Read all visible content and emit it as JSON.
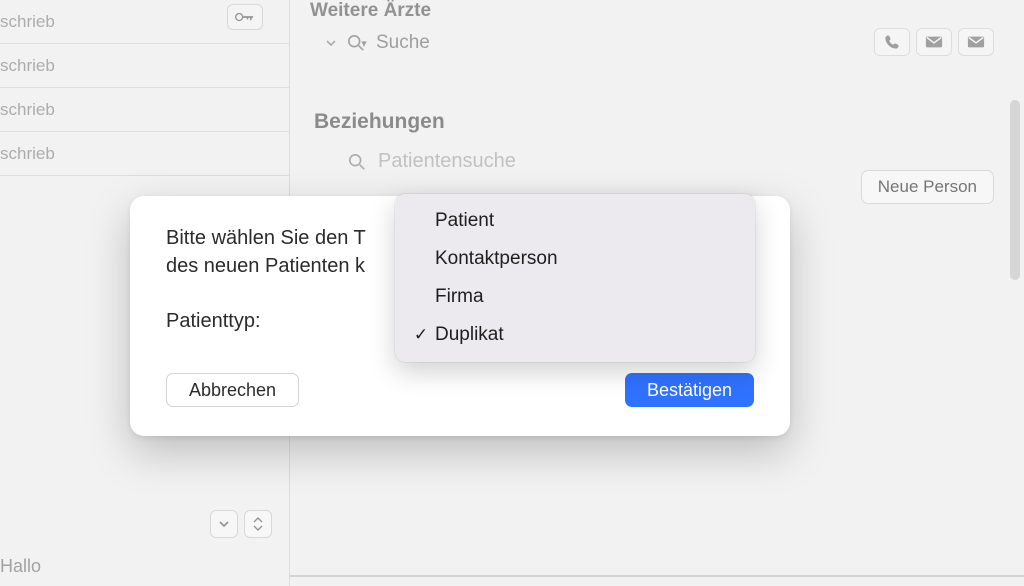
{
  "sidebar": {
    "items": [
      "schrieb",
      "schrieb",
      "schrieb",
      "schrieb"
    ],
    "note": "Hallo"
  },
  "content": {
    "section1_title": "Weitere Ärzte",
    "search_placeholder": "Suche",
    "section2_title": "Beziehungen",
    "patient_search_placeholder": "Patientensuche",
    "new_person_label": "Neue Person"
  },
  "dialog": {
    "line1": "Bitte wählen Sie den T",
    "line2": "des neuen Patienten k",
    "field_label": "Patienttyp:",
    "cancel_label": "Abbrechen",
    "confirm_label": "Bestätigen"
  },
  "dropdown": {
    "options": [
      {
        "label": "Patient",
        "selected": false
      },
      {
        "label": "Kontaktperson",
        "selected": false
      },
      {
        "label": "Firma",
        "selected": false
      },
      {
        "label": "Duplikat",
        "selected": true
      }
    ]
  }
}
